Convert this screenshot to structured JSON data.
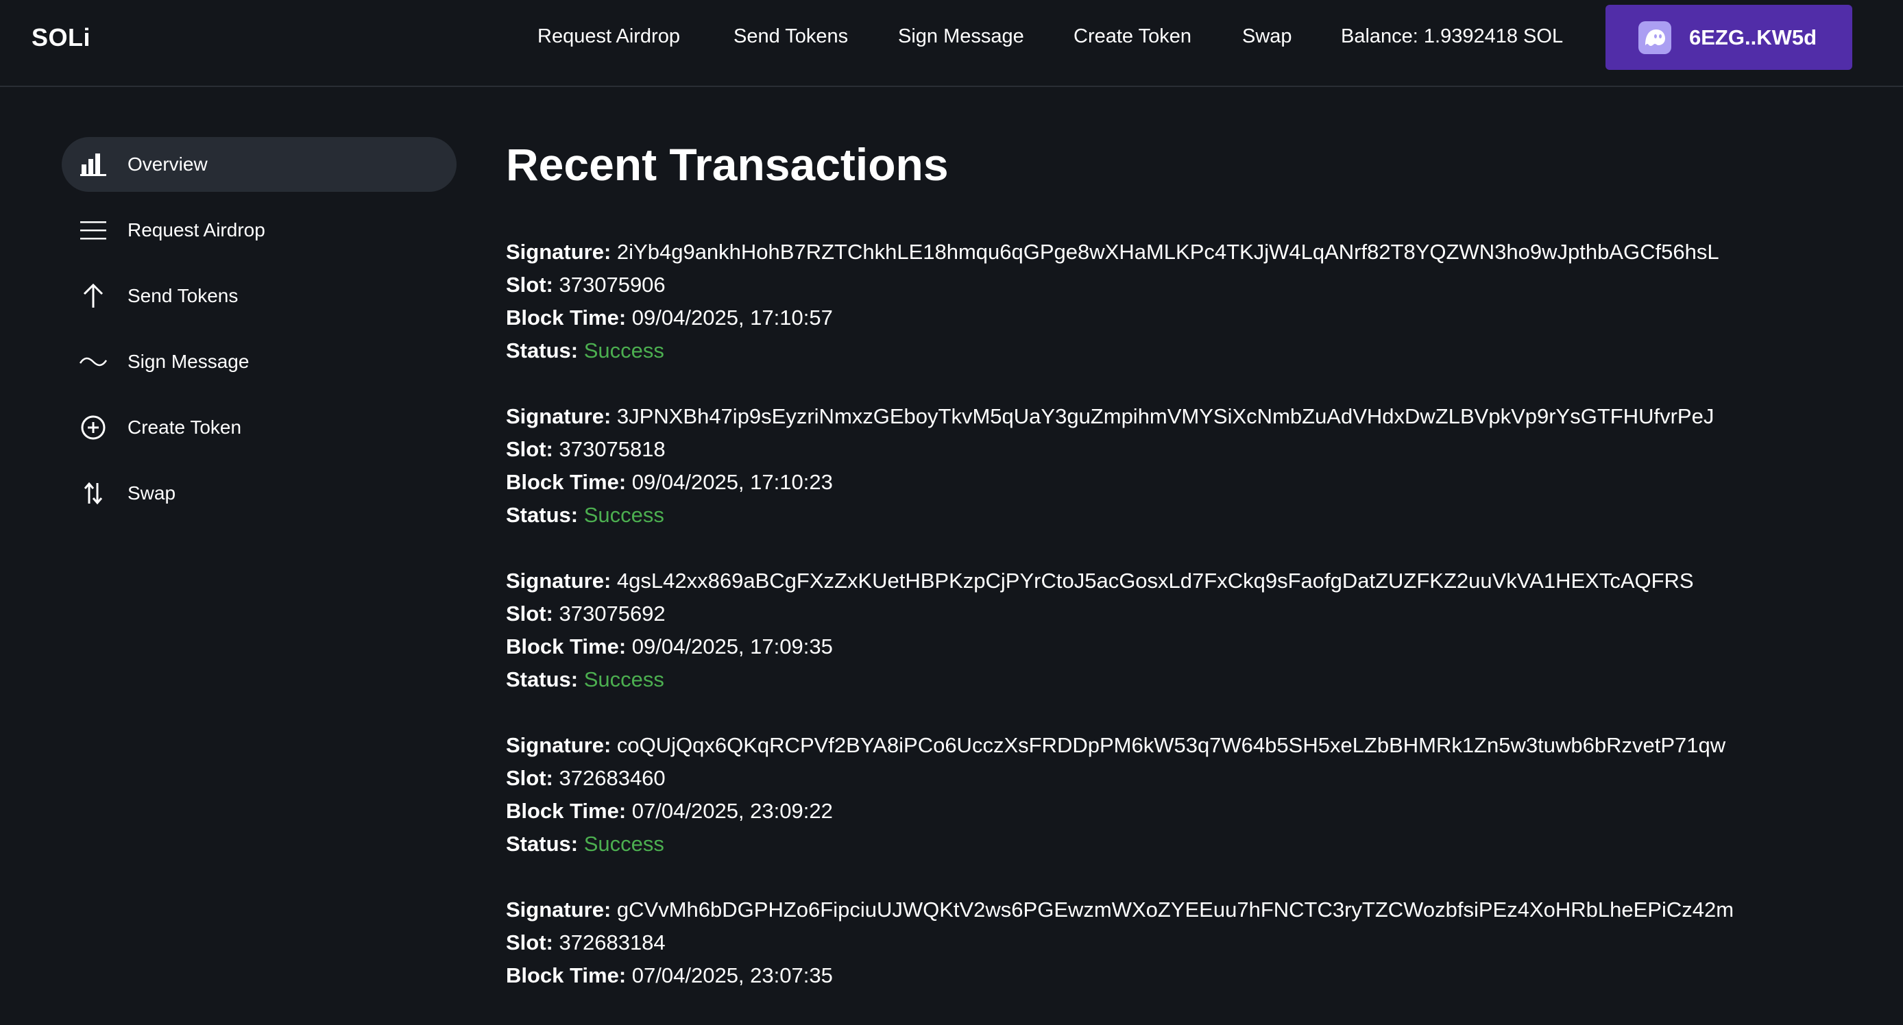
{
  "header": {
    "brand": "SOLi",
    "nav": [
      {
        "label": "Request Airdrop"
      },
      {
        "label": "Send Tokens"
      },
      {
        "label": "Sign Message"
      },
      {
        "label": "Create Token"
      },
      {
        "label": "Swap"
      }
    ],
    "balance": "Balance: 1.9392418 SOL",
    "wallet": {
      "label": "6EZG..KW5d",
      "icon": "phantom-ghost-icon",
      "color": "#512da8"
    }
  },
  "sidebar": {
    "items": [
      {
        "label": "Overview",
        "icon": "bar-chart-icon",
        "active": true
      },
      {
        "label": "Request Airdrop",
        "icon": "menu-lines-icon"
      },
      {
        "label": "Send Tokens",
        "icon": "arrow-up-icon"
      },
      {
        "label": "Sign Message",
        "icon": "wave-icon"
      },
      {
        "label": "Create Token",
        "icon": "plus-circle-icon"
      },
      {
        "label": "Swap",
        "icon": "swap-arrows-icon"
      }
    ]
  },
  "main": {
    "title": "Recent Transactions",
    "labels": {
      "signature": "Signature:",
      "slot": "Slot:",
      "block_time": "Block Time:",
      "status": "Status:"
    },
    "status_color": "#4caf50",
    "transactions": [
      {
        "signature": "2iYb4g9ankhHohB7RZTChkhLE18hmqu6qGPge8wXHaMLKPc4TKJjW4LqANrf82T8YQZWN3ho9wJpthbAGCf56hsL",
        "slot": "373075906",
        "block_time": "09/04/2025, 17:10:57",
        "status": "Success"
      },
      {
        "signature": "3JPNXBh47ip9sEyzriNmxzGEboyTkvM5qUaY3guZmpihmVMYSiXcNmbZuAdVHdxDwZLBVpkVp9rYsGTFHUfvrPeJ",
        "slot": "373075818",
        "block_time": "09/04/2025, 17:10:23",
        "status": "Success"
      },
      {
        "signature": "4gsL42xx869aBCgFXzZxKUetHBPKzpCjPYrCtoJ5acGosxLd7FxCkq9sFaofgDatZUZFKZ2uuVkVA1HEXTcAQFRS",
        "slot": "373075692",
        "block_time": "09/04/2025, 17:09:35",
        "status": "Success"
      },
      {
        "signature": "coQUjQqx6QKqRCPVf2BYA8iPCo6UcczXsFRDDpPM6kW53q7W64b5SH5xeLZbBHMRk1Zn5w3tuwb6bRzvetP71qw",
        "slot": "372683460",
        "block_time": "07/04/2025, 23:09:22",
        "status": "Success"
      },
      {
        "signature": "gCVvMh6bDGPHZo6FipciuUJWQKtV2ws6PGEwzmWXoZYEEuu7hFNCTC3ryTZCWozbfsiPEz4XoHRbLheEPiCz42m",
        "slot": "372683184",
        "block_time": "07/04/2025, 23:07:35",
        "status": ""
      }
    ]
  }
}
